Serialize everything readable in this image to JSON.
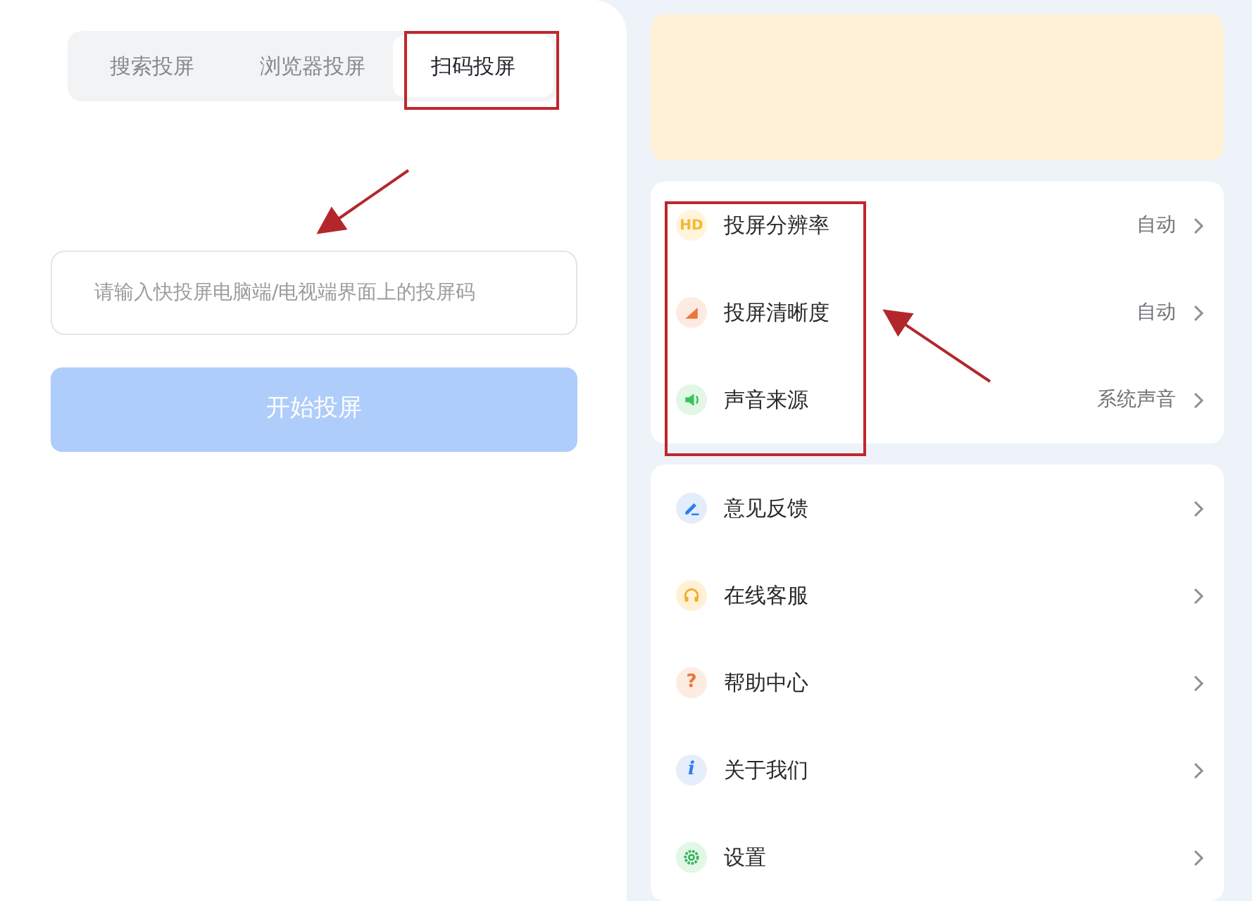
{
  "tabs": [
    {
      "label": "搜索投屏",
      "selected": false
    },
    {
      "label": "浏览器投屏",
      "selected": false
    },
    {
      "label": "扫码投屏",
      "selected": true
    }
  ],
  "code_field": {
    "placeholder": "请输入快投屏电脑端/电视端界面上的投屏码"
  },
  "start_button": {
    "label": "开始投屏",
    "disabled": true
  },
  "settings_list": [
    {
      "kind": "hd",
      "glyph": "HD",
      "label": "投屏分辨率",
      "value": "自动"
    },
    {
      "kind": "signal",
      "label": "投屏清晰度",
      "value": "自动"
    },
    {
      "kind": "sound",
      "label": "声音来源",
      "value": "系统声音"
    }
  ],
  "menu_list": [
    {
      "kind": "pen",
      "label": "意见反馈"
    },
    {
      "kind": "headset",
      "label": "在线客服"
    },
    {
      "kind": "help",
      "glyph": "?",
      "label": "帮助中心"
    },
    {
      "kind": "info",
      "glyph": "i",
      "label": "关于我们"
    },
    {
      "kind": "gear",
      "label": "设置"
    }
  ],
  "annotations": [
    {
      "kind": "box"
    },
    {
      "kind": "arrow"
    },
    {
      "kind": "box"
    },
    {
      "kind": "arrow"
    }
  ]
}
